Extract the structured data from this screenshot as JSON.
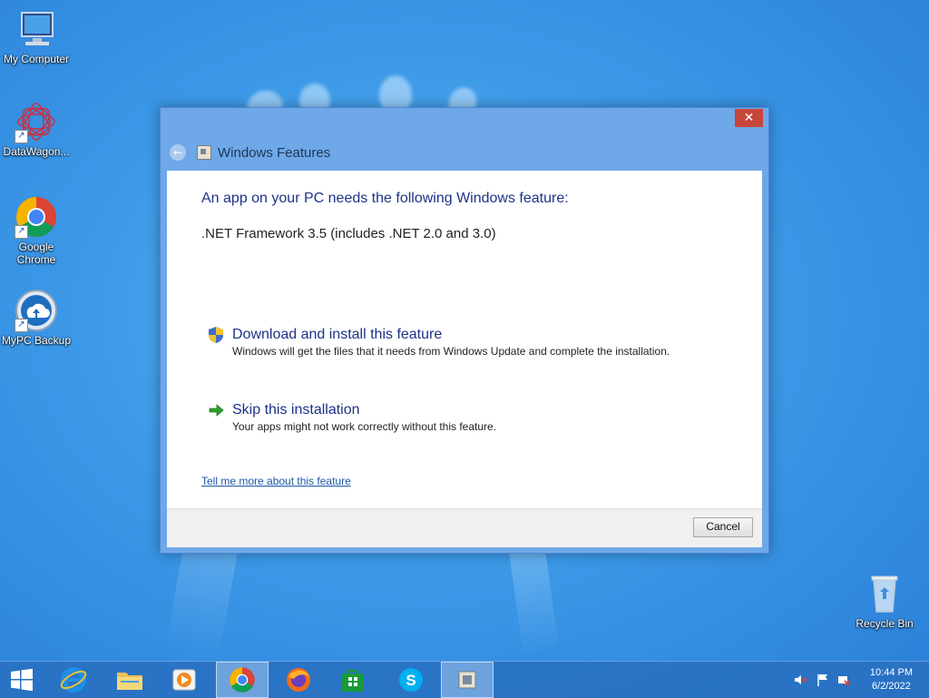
{
  "desktop": {
    "icons": [
      {
        "label": "My Computer",
        "icon": "computer-icon"
      },
      {
        "label": "DataWagon...",
        "icon": "datawagon-icon"
      },
      {
        "label": "Google Chrome",
        "icon": "chrome-icon"
      },
      {
        "label": "MyPC Backup",
        "icon": "backup-icon"
      },
      {
        "label": "Recycle Bin",
        "icon": "recycle-bin-icon"
      }
    ]
  },
  "dialog": {
    "title": "Windows Features",
    "close_symbol": "✕",
    "back_symbol": "←",
    "heading": "An app on your PC needs the following Windows feature:",
    "feature": ".NET Framework 3.5 (includes .NET 2.0 and 3.0)",
    "options": [
      {
        "icon": "shield-icon",
        "title": "Download and install this feature",
        "description": "Windows will get the files that it needs from Windows Update and complete the installation."
      },
      {
        "icon": "green-arrow-icon",
        "title": "Skip this installation",
        "description": "Your apps might not work correctly without this feature."
      }
    ],
    "link": "Tell me more about this feature",
    "cancel_label": "Cancel"
  },
  "taskbar": {
    "items": [
      {
        "name": "start-button",
        "icon": "windows-logo-icon"
      },
      {
        "name": "internet-explorer",
        "icon": "ie-icon"
      },
      {
        "name": "file-explorer",
        "icon": "folder-icon"
      },
      {
        "name": "media-player",
        "icon": "media-icon"
      },
      {
        "name": "google-chrome",
        "icon": "chrome-icon",
        "active": true
      },
      {
        "name": "firefox",
        "icon": "firefox-icon"
      },
      {
        "name": "store",
        "icon": "store-icon"
      },
      {
        "name": "skype",
        "icon": "skype-icon"
      },
      {
        "name": "windows-features",
        "icon": "windows-features-icon",
        "active": true
      }
    ],
    "clock": {
      "time": "10:44 PM",
      "date": "6/2/2022"
    }
  },
  "colors": {
    "accent": "#1e3287",
    "titlebar": "#6ea8e8",
    "close": "#c7463a",
    "link": "#1a56a8"
  }
}
